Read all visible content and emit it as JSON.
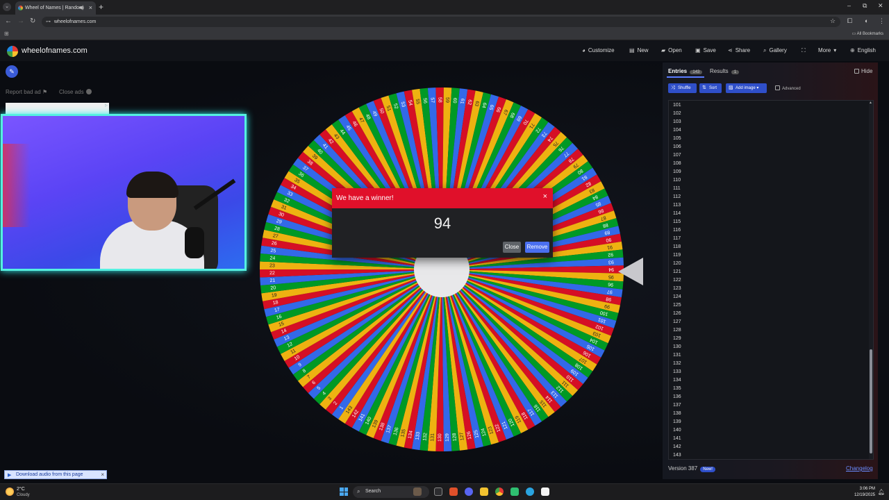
{
  "browser": {
    "tab_title": "Wheel of Names | Random",
    "new_tab": "+",
    "url": "wheelofnames.com",
    "all_bookmarks": "All Bookmarks"
  },
  "app": {
    "site_name": "wheelofnames.com",
    "nav": {
      "customize": "Customize",
      "new": "New",
      "open": "Open",
      "save": "Save",
      "share": "Share",
      "gallery": "Gallery",
      "more": "More",
      "language": "English"
    },
    "ad": {
      "report": "Report bad ad",
      "close": "Close ads"
    }
  },
  "wheel": {
    "segment_count": 143,
    "colors": [
      "#3369e8",
      "#d50f25",
      "#eeb211",
      "#009925"
    ],
    "labels": [
      "1",
      "2",
      "3",
      "4",
      "5",
      "6",
      "7",
      "8",
      "9",
      "10",
      "11",
      "12",
      "13",
      "14",
      "15",
      "16",
      "17",
      "18",
      "19",
      "20",
      "21",
      "22",
      "23",
      "24",
      "25",
      "26",
      "27",
      "28",
      "29",
      "30",
      "31",
      "32",
      "33",
      "34",
      "35",
      "36",
      "37",
      "38",
      "39",
      "40",
      "41",
      "42",
      "43",
      "44",
      "45",
      "46",
      "47",
      "48",
      "49",
      "50",
      "51",
      "52",
      "53",
      "54",
      "55",
      "56",
      "57",
      "58",
      "59",
      "60",
      "61",
      "62",
      "63",
      "64",
      "65",
      "66",
      "67",
      "68",
      "69",
      "70",
      "71",
      "72",
      "73",
      "74",
      "75",
      "76",
      "77",
      "78",
      "79",
      "80",
      "81",
      "82",
      "83",
      "84",
      "85",
      "86",
      "87",
      "88",
      "89",
      "90",
      "91",
      "92",
      "93",
      "94",
      "95",
      "96",
      "97",
      "98",
      "99",
      "100",
      "101",
      "102",
      "103",
      "104",
      "105",
      "106",
      "107",
      "108",
      "109",
      "110",
      "111",
      "112",
      "113",
      "114",
      "115",
      "116",
      "117",
      "118",
      "119",
      "120",
      "121",
      "122",
      "123",
      "124",
      "125",
      "126",
      "127",
      "128",
      "129",
      "130",
      "131",
      "132",
      "133",
      "134",
      "135",
      "136",
      "137",
      "138",
      "139",
      "140",
      "141",
      "142",
      "143"
    ]
  },
  "dialog": {
    "title": "We have a winner!",
    "close_x": "×",
    "winner": "94",
    "close_label": "Close",
    "remove_label": "Remove"
  },
  "panel": {
    "entries_tab": "Entries",
    "entries_count": "143",
    "results_tab": "Results",
    "results_count": "1",
    "hide_label": "Hide",
    "shuffle_label": "Shuffle",
    "sort_label": "Sort",
    "add_image_label": "Add image",
    "advanced_label": "Advanced",
    "visible_entries": [
      "101",
      "102",
      "103",
      "104",
      "105",
      "106",
      "107",
      "108",
      "109",
      "110",
      "111",
      "112",
      "113",
      "114",
      "115",
      "116",
      "117",
      "118",
      "119",
      "120",
      "121",
      "122",
      "123",
      "124",
      "125",
      "126",
      "127",
      "128",
      "129",
      "130",
      "131",
      "132",
      "133",
      "134",
      "135",
      "136",
      "137",
      "138",
      "139",
      "140",
      "141",
      "142",
      "143"
    ],
    "version": "Version 387",
    "new_badge": "New!",
    "changelog": "Changelog"
  },
  "download_bar": {
    "label": "Download audio from this page"
  },
  "taskbar": {
    "temp": "2°C",
    "weather": "Cloudy",
    "search": "Search",
    "time": "3:06 PM",
    "date": "12/19/2025"
  }
}
